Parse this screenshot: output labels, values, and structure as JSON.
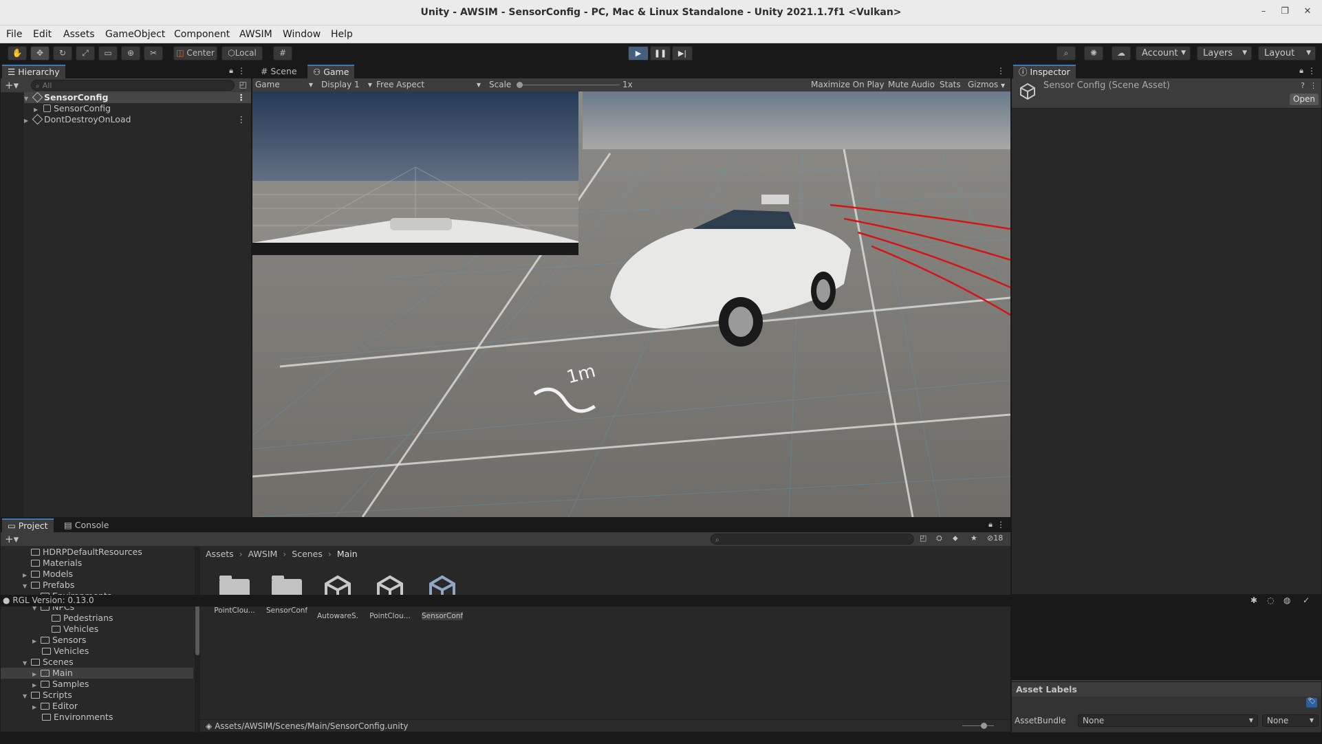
{
  "window": {
    "title": "Unity - AWSIM - SensorConfig - PC, Mac & Linux Standalone - Unity 2021.1.7f1 <Vulkan>"
  },
  "menu": [
    "File",
    "Edit",
    "Assets",
    "GameObject",
    "Component",
    "AWSIM",
    "Window",
    "Help"
  ],
  "toolbar": {
    "pivot": "Center",
    "space": "Local",
    "account": "Account",
    "layers": "Layers",
    "layout": "Layout"
  },
  "hierarchy": {
    "tab": "Hierarchy",
    "search_placeholder": "All",
    "items": [
      {
        "label": "SensorConfig"
      },
      {
        "label": "SensorConfig"
      },
      {
        "label": "DontDestroyOnLoad"
      }
    ]
  },
  "game_view": {
    "tabs": [
      "Scene",
      "Game"
    ],
    "mode": "Game",
    "display": "Display 1",
    "aspect": "Free Aspect",
    "scale_label": "Scale",
    "scale_value": "1x",
    "buttons": [
      "Maximize On Play",
      "Mute Audio",
      "Stats",
      "Gizmos"
    ],
    "marker": "1m"
  },
  "inspector": {
    "tab": "Inspector",
    "asset_title": "Sensor Config (Scene Asset)",
    "open_button": "Open",
    "asset_labels": "Asset Labels",
    "assetbundle_label": "AssetBundle",
    "assetbundle_value": "None",
    "variant_value": "None"
  },
  "project": {
    "tabs": [
      "Project",
      "Console"
    ],
    "hidden_count": "18",
    "tree": [
      {
        "label": "HDRPDefaultResources"
      },
      {
        "label": "Materials"
      },
      {
        "label": "Models"
      },
      {
        "label": "Prefabs"
      },
      {
        "label": "Environments"
      },
      {
        "label": "NPCs"
      },
      {
        "label": "Pedestrians"
      },
      {
        "label": "Vehicles"
      },
      {
        "label": "Sensors"
      },
      {
        "label": "Vehicles"
      },
      {
        "label": "Scenes"
      },
      {
        "label": "Main"
      },
      {
        "label": "Samples"
      },
      {
        "label": "Scripts"
      },
      {
        "label": "Editor"
      },
      {
        "label": "Environments"
      }
    ],
    "breadcrumb": [
      "Assets",
      "AWSIM",
      "Scenes",
      "Main"
    ],
    "assets": [
      {
        "label": "PointClou...",
        "kind": "folder"
      },
      {
        "label": "SensorConf...",
        "kind": "folder"
      },
      {
        "label": "AutowareS...",
        "kind": "scene"
      },
      {
        "label": "PointClou...",
        "kind": "scene"
      },
      {
        "label": "SensorConf...",
        "kind": "scene"
      }
    ],
    "path": "Assets/AWSIM/Scenes/Main/SensorConfig.unity"
  },
  "status": {
    "text": "RGL Version: 0.13.0"
  },
  "colors": {
    "accent": "#3a79bb",
    "play_active": "#46607c",
    "panel": "#282828"
  }
}
